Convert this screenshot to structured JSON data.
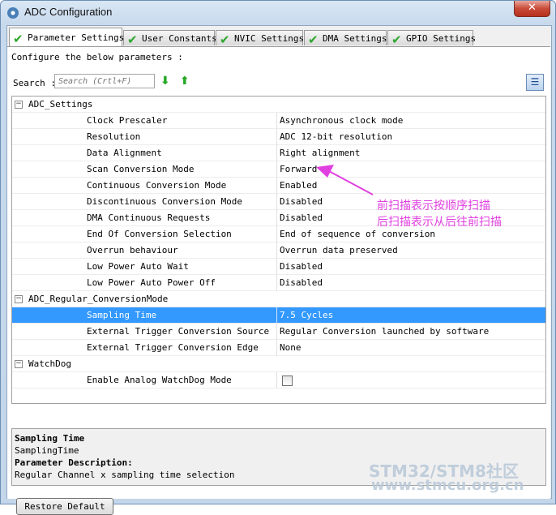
{
  "window": {
    "title": "ADC Configuration",
    "close_glyph": "✕"
  },
  "tabs": [
    {
      "label": "Parameter Settings",
      "icon": "check-icon",
      "active": true
    },
    {
      "label": "User Constants",
      "icon": "check-icon",
      "active": false
    },
    {
      "label": "NVIC Settings",
      "icon": "check-icon",
      "active": false
    },
    {
      "label": "DMA Settings",
      "icon": "check-icon",
      "active": false
    },
    {
      "label": "GPIO Settings",
      "icon": "check-icon",
      "active": false
    }
  ],
  "configure_text": "Configure the below parameters :",
  "search": {
    "label": "Search :",
    "placeholder": "Search (Crtl+F)"
  },
  "groups": [
    {
      "name": "ADC_Settings",
      "params": [
        {
          "name": "Clock Prescaler",
          "value": "Asynchronous clock mode"
        },
        {
          "name": "Resolution",
          "value": "ADC 12-bit resolution"
        },
        {
          "name": "Data Alignment",
          "value": "Right alignment"
        },
        {
          "name": "Scan Conversion Mode",
          "value": "Forward"
        },
        {
          "name": "Continuous Conversion Mode",
          "value": "Enabled"
        },
        {
          "name": "Discontinuous Conversion Mode",
          "value": "Disabled"
        },
        {
          "name": "DMA Continuous Requests",
          "value": "Disabled"
        },
        {
          "name": "End Of Conversion Selection",
          "value": "End of sequence of conversion"
        },
        {
          "name": "Overrun behaviour",
          "value": "Overrun data preserved"
        },
        {
          "name": "Low Power Auto Wait",
          "value": "Disabled"
        },
        {
          "name": "Low Power Auto Power Off",
          "value": "Disabled"
        }
      ]
    },
    {
      "name": "ADC_Regular_ConversionMode",
      "params": [
        {
          "name": "Sampling Time",
          "value": "7.5 Cycles",
          "selected": true
        },
        {
          "name": "External Trigger Conversion Source",
          "value": "Regular Conversion launched by software"
        },
        {
          "name": "External Trigger Conversion Edge",
          "value": "None"
        }
      ]
    },
    {
      "name": "WatchDog",
      "params": [
        {
          "name": "Enable Analog WatchDog Mode",
          "value": "",
          "checkbox": true,
          "checked": false
        }
      ]
    }
  ],
  "description": {
    "title": "Sampling Time",
    "param_id": "SamplingTime",
    "heading": "Parameter Description:",
    "text": "Regular Channel x sampling time selection"
  },
  "restore_button": "Restore Default",
  "annotation": {
    "line1": "前扫描表示按顺序扫描",
    "line2": "后扫描表示从后往前扫描",
    "color": "#e040e0"
  },
  "watermark": {
    "line1": "STM32/STM8社区",
    "line2": "www.stmcu.org.cn"
  }
}
